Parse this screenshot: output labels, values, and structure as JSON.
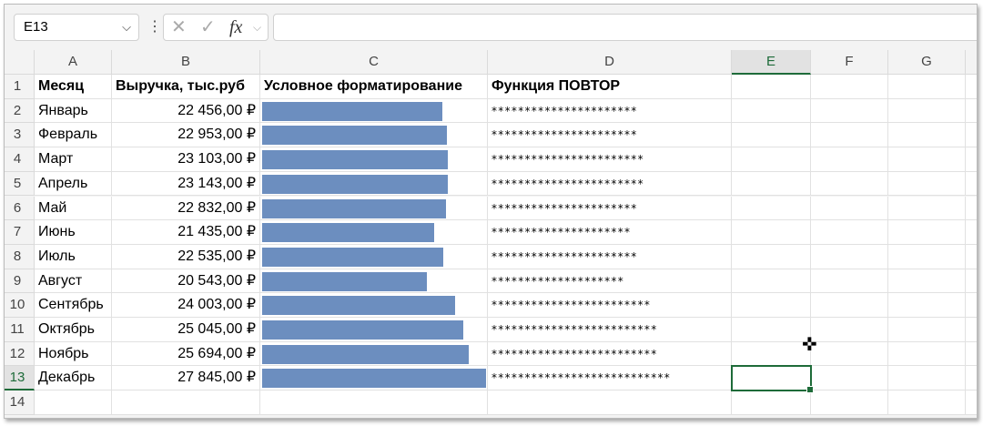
{
  "formula_bar": {
    "name_box": "E13",
    "formula": "",
    "cancel_icon": "✕",
    "enter_icon": "✓",
    "fx_label": "fx"
  },
  "columns": [
    "A",
    "B",
    "C",
    "D",
    "E",
    "F",
    "G"
  ],
  "selected_column": "E",
  "headers": {
    "month": "Месяц",
    "revenue": "Выручка, тыс.руб",
    "cond": "Условное форматирование",
    "rept": "Функция ПОВТОР"
  },
  "rows": [
    {
      "month": "Январь",
      "value": 22456,
      "display": "22 456,00 ₽"
    },
    {
      "month": "Февраль",
      "value": 22953,
      "display": "22 953,00 ₽"
    },
    {
      "month": "Март",
      "value": 23103,
      "display": "23 103,00 ₽"
    },
    {
      "month": "Апрель",
      "value": 23143,
      "display": "23 143,00 ₽"
    },
    {
      "month": "Май",
      "value": 22832,
      "display": "22 832,00 ₽"
    },
    {
      "month": "Июнь",
      "value": 21435,
      "display": "21 435,00 ₽"
    },
    {
      "month": "Июль",
      "value": 22535,
      "display": "22 535,00 ₽"
    },
    {
      "month": "Август",
      "value": 20543,
      "display": "20 543,00 ₽"
    },
    {
      "month": "Сентябрь",
      "value": 24003,
      "display": "24 003,00 ₽"
    },
    {
      "month": "Октябрь",
      "value": 25045,
      "display": "25 045,00 ₽"
    },
    {
      "month": "Ноябрь",
      "value": 25694,
      "display": "25 694,00 ₽"
    },
    {
      "month": "Декабрь",
      "value": 27845,
      "display": "27 845,00 ₽"
    }
  ],
  "bar_color": "#6c8ebf",
  "accent": "#1e6b39"
}
